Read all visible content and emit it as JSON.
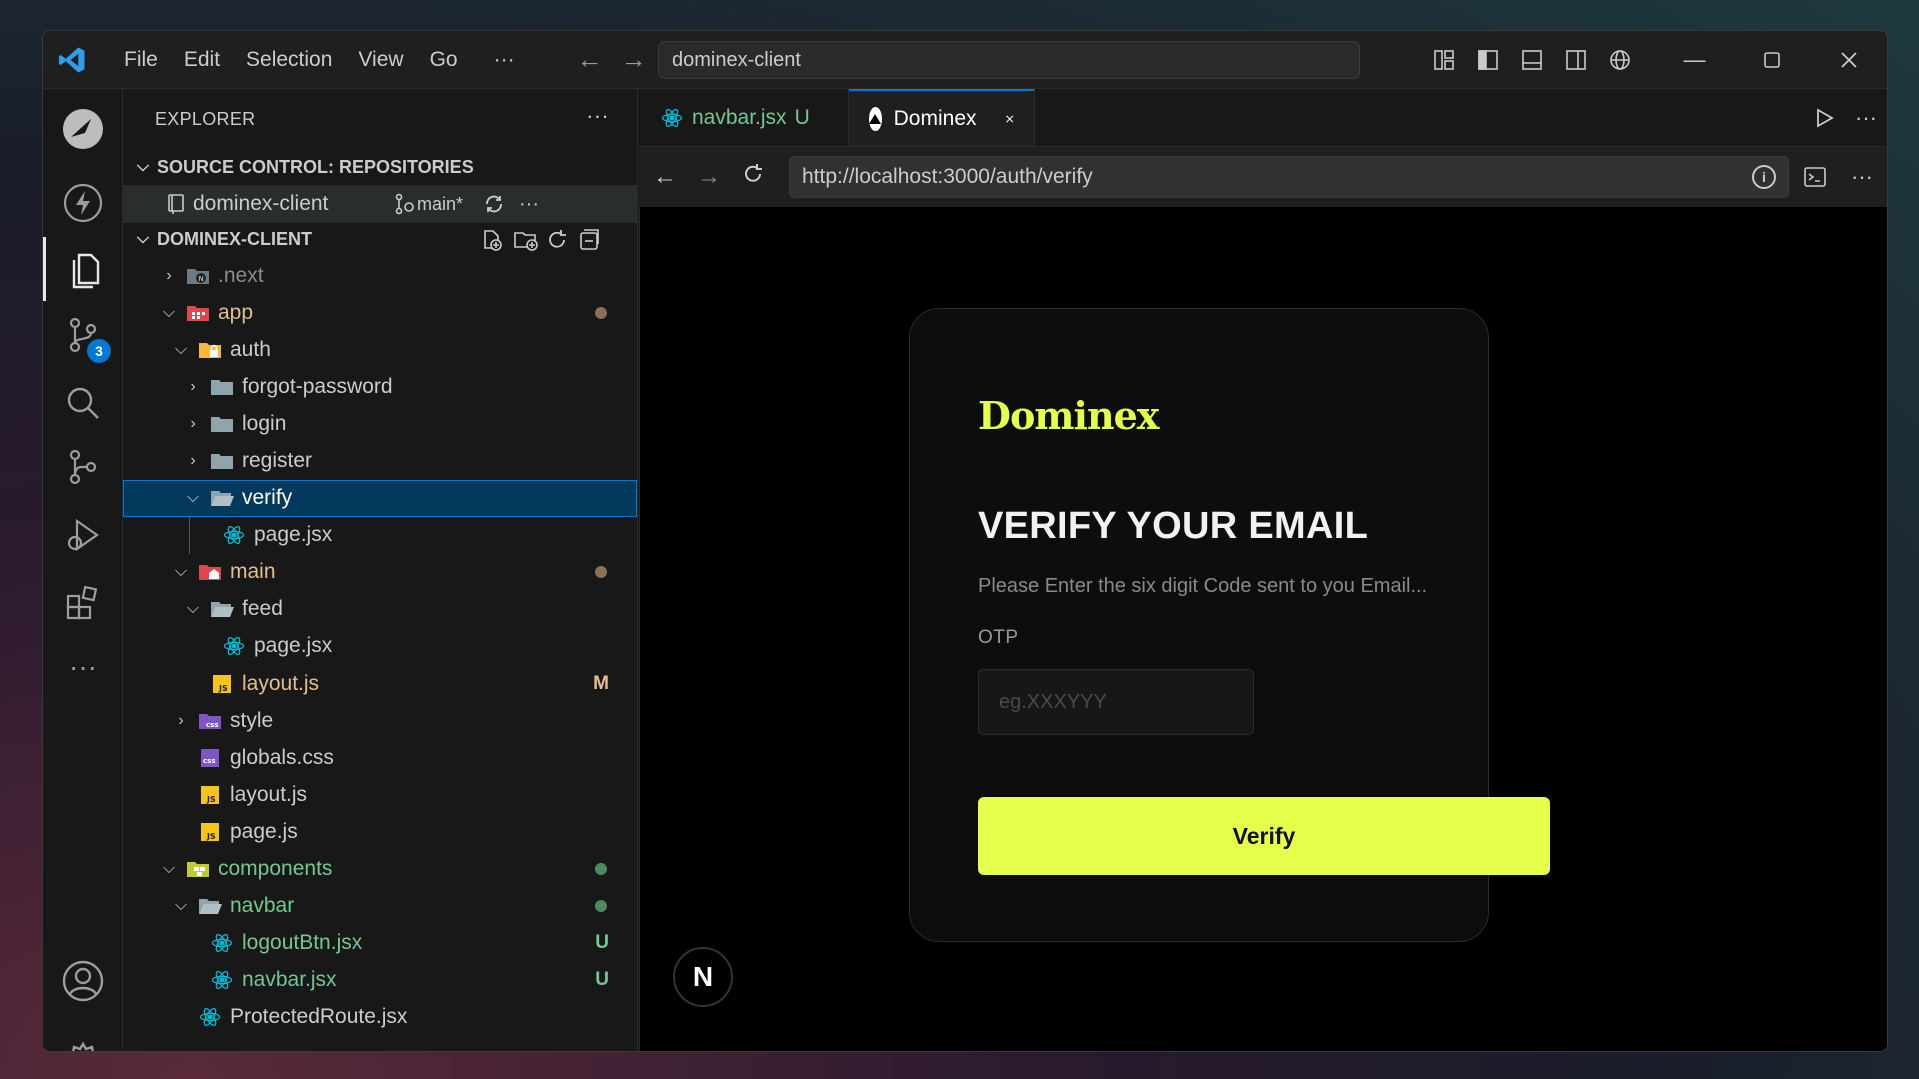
{
  "titlebar": {
    "menus": [
      "File",
      "Edit",
      "Selection",
      "View",
      "Go",
      "···"
    ],
    "search": "dominex-client"
  },
  "activity": {
    "source_control_badge": "3"
  },
  "sidebar": {
    "header": "EXPLORER",
    "header_more": "···",
    "source_control_title": "SOURCE CONTROL: REPOSITORIES",
    "repo_name": "dominex-client",
    "repo_branch": "main*",
    "repo_more": "···",
    "project_title": "DOMINEX-CLIENT",
    "tree": {
      "next": ".next",
      "app": "app",
      "auth": "auth",
      "forgot_password": "forgot-password",
      "login": "login",
      "register": "register",
      "verify": "verify",
      "verify_page": "page.jsx",
      "main": "main",
      "feed": "feed",
      "feed_page": "page.jsx",
      "main_layout": "layout.js",
      "main_layout_status": "M",
      "style": "style",
      "globals": "globals.css",
      "layout": "layout.js",
      "page": "page.js",
      "components": "components",
      "navbar": "navbar",
      "logout_btn": "logoutBtn.jsx",
      "logout_btn_status": "U",
      "navbar_jsx": "navbar.jsx",
      "navbar_jsx_status": "U",
      "protected_route": "ProtectedRoute.jsx"
    }
  },
  "tabs": {
    "tab1_label": "navbar.jsx",
    "tab1_status": "U",
    "tab2_label": "Dominex",
    "more": "···"
  },
  "browser": {
    "url": "http://localhost:3000/auth/verify",
    "more": "···"
  },
  "page": {
    "brand": "Dominex",
    "title": "VERIFY YOUR EMAIL",
    "subtitle": "Please Enter the six digit Code sent to you Email...",
    "otp_label": "OTP",
    "otp_placeholder": "eg.XXXYYY",
    "verify_button": "Verify",
    "next_badge": "N"
  },
  "colors": {
    "accent": "#e6ff4a",
    "untracked": "#73c991",
    "modified": "#e2c08d",
    "selection": "#04395e"
  }
}
